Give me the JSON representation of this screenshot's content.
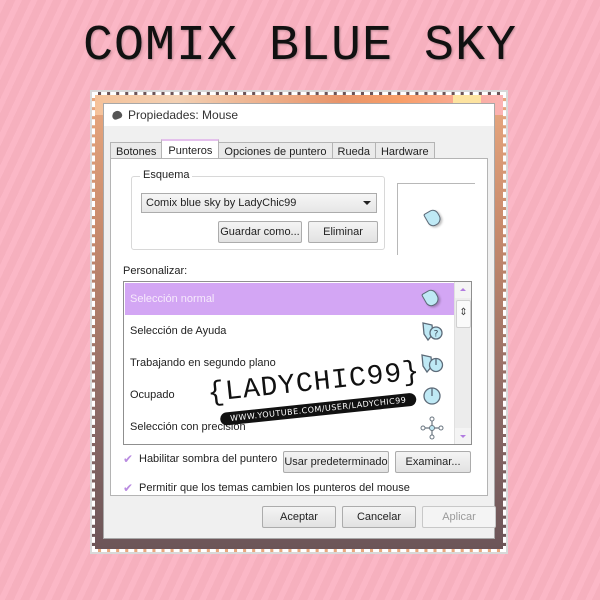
{
  "page_title": "COMIX BLUE SKY",
  "window": {
    "title": "Propiedades: Mouse",
    "tabs": [
      {
        "label": "Botones",
        "active": false
      },
      {
        "label": "Punteros",
        "active": true
      },
      {
        "label": "Opciones de puntero",
        "active": false
      },
      {
        "label": "Rueda",
        "active": false
      },
      {
        "label": "Hardware",
        "active": false
      }
    ]
  },
  "scheme": {
    "legend": "Esquema",
    "selected": "Comix blue sky by LadyChic99",
    "save_as_label": "Guardar como...",
    "delete_label": "Eliminar"
  },
  "customize": {
    "label": "Personalizar:",
    "items": [
      {
        "label": "Selección normal",
        "icon": "arrow-pointer-icon",
        "selected": true
      },
      {
        "label": "Selección de Ayuda",
        "icon": "help-pointer-icon",
        "selected": false
      },
      {
        "label": "Trabajando en segundo plano",
        "icon": "working-background-icon",
        "selected": false
      },
      {
        "label": "Ocupado",
        "icon": "busy-icon",
        "selected": false
      },
      {
        "label": "Selección con precisión",
        "icon": "precision-crosshair-icon",
        "selected": false
      }
    ]
  },
  "options": {
    "shadow_label": "Habilitar sombra del puntero",
    "shadow_checked": true,
    "themes_label": "Permitir que los temas cambien los punteros del mouse",
    "themes_checked": true,
    "use_default_label": "Usar predeterminado",
    "browse_label": "Examinar..."
  },
  "footer": {
    "ok_label": "Aceptar",
    "cancel_label": "Cancelar",
    "apply_label": "Aplicar"
  },
  "watermark": {
    "main": "{LADYCHIC99}",
    "url": "WWW.YOUTUBE.COM/USER/LADYCHIC99"
  },
  "colors": {
    "background": "#fbb3c2",
    "selection": "#d3a6f4",
    "cursor_fill": "#bfe9f5",
    "checkmark": "#b98be0"
  }
}
